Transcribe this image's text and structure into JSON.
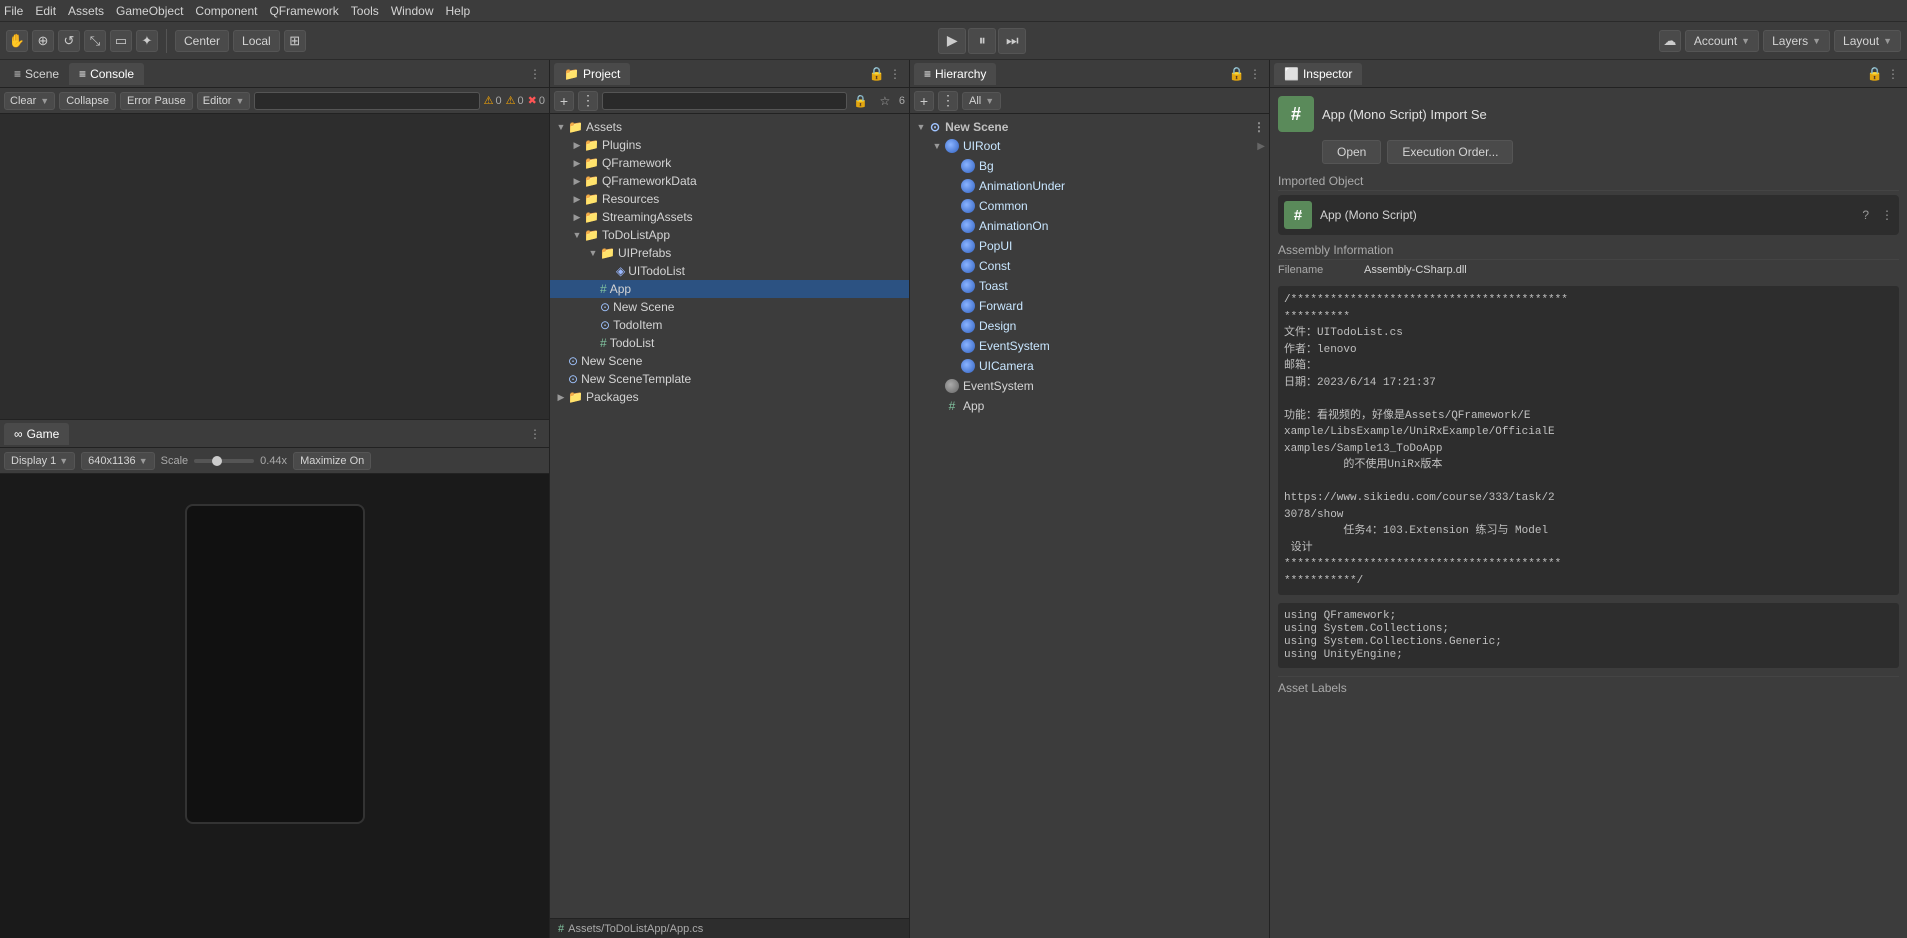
{
  "menuBar": {
    "items": [
      "File",
      "Edit",
      "Assets",
      "GameObject",
      "Component",
      "QFramework",
      "Tools",
      "Window",
      "Help"
    ]
  },
  "toolbar": {
    "handTool": "✋",
    "moveTool": "⊕",
    "rotateTool": "↺",
    "scaleTool": "⤡",
    "rectTool": "▭",
    "transformTool": "✦",
    "pivotBtn": "Center",
    "spaceBtn": "Local",
    "customBtn": "⊞",
    "playBtn": "▶",
    "pauseBtn": "⏸",
    "stepBtn": "⏭",
    "cloudIcon": "☁",
    "accountBtn": "Account",
    "layersBtn": "Layers",
    "layoutBtn": "Layout"
  },
  "scenePanel": {
    "tabs": [
      {
        "label": "Scene",
        "icon": "≡",
        "active": false
      },
      {
        "label": "Console",
        "icon": "≡",
        "active": true
      }
    ],
    "consoleBtns": [
      "Clear",
      "Collapse",
      "Error Pause"
    ],
    "editorDropdown": "Editor",
    "badges": [
      {
        "icon": "⚠",
        "count": "0"
      },
      {
        "icon": "⚠",
        "count": "0"
      },
      {
        "icon": "✖",
        "count": "0"
      }
    ]
  },
  "gamePanel": {
    "title": "Game",
    "displayDropdown": "Display 1",
    "resolutionDropdown": "640x1136",
    "scaleLabel": "Scale",
    "scaleValue": "0.44x",
    "maximizeBtn": "Maximize On"
  },
  "projectPanel": {
    "title": "Project",
    "lockIcon": "🔒",
    "tree": {
      "root": "Assets",
      "items": [
        {
          "id": "plugins",
          "label": "Plugins",
          "type": "folder",
          "depth": 1,
          "expanded": false
        },
        {
          "id": "qframework",
          "label": "QFramework",
          "type": "folder",
          "depth": 1,
          "expanded": false
        },
        {
          "id": "qframeworkdata",
          "label": "QFrameworkData",
          "type": "folder",
          "depth": 1,
          "expanded": false
        },
        {
          "id": "resources",
          "label": "Resources",
          "type": "folder",
          "depth": 1,
          "expanded": false
        },
        {
          "id": "streamingassets",
          "label": "StreamingAssets",
          "type": "folder",
          "depth": 1,
          "expanded": false
        },
        {
          "id": "todolistapp",
          "label": "ToDoListApp",
          "type": "folder",
          "depth": 1,
          "expanded": true
        },
        {
          "id": "uiprefabs",
          "label": "UIPrefabs",
          "type": "folder",
          "depth": 2,
          "expanded": true
        },
        {
          "id": "uitodolist",
          "label": "UITodoList",
          "type": "prefab",
          "depth": 3
        },
        {
          "id": "app",
          "label": "App",
          "type": "script",
          "depth": 2
        },
        {
          "id": "newscene",
          "label": "New Scene",
          "type": "scene",
          "depth": 2
        },
        {
          "id": "todoitem",
          "label": "TodoItem",
          "type": "scene",
          "depth": 2
        },
        {
          "id": "todolist",
          "label": "TodoList",
          "type": "script",
          "depth": 2
        }
      ],
      "rootItems2": [
        {
          "id": "newscene2",
          "label": "New Scene",
          "type": "scene",
          "depth": 0
        },
        {
          "id": "newscenetemplate",
          "label": "New SceneTemplate",
          "type": "scene",
          "depth": 0
        }
      ],
      "packagesFolder": "Packages"
    },
    "statusBar": "Assets/ToDoListApp/App.cs"
  },
  "hierarchyPanel": {
    "title": "Hierarchy",
    "allDropdown": "All",
    "scene": {
      "name": "New Scene",
      "children": [
        {
          "id": "uiroot",
          "label": "UIRoot",
          "type": "component",
          "depth": 1,
          "expanded": true,
          "children": [
            {
              "id": "bg",
              "label": "Bg",
              "type": "component",
              "depth": 2
            },
            {
              "id": "animunder",
              "label": "AnimationUnder",
              "type": "component",
              "depth": 2
            },
            {
              "id": "common",
              "label": "Common",
              "type": "component",
              "depth": 2
            },
            {
              "id": "animon",
              "label": "AnimationOn",
              "type": "component",
              "depth": 2
            },
            {
              "id": "popui",
              "label": "PopUI",
              "type": "component",
              "depth": 2
            },
            {
              "id": "const",
              "label": "Const",
              "type": "component",
              "depth": 2
            },
            {
              "id": "toast",
              "label": "Toast",
              "type": "component",
              "depth": 2
            },
            {
              "id": "forward",
              "label": "Forward",
              "type": "component",
              "depth": 2
            },
            {
              "id": "design",
              "label": "Design",
              "type": "component",
              "depth": 2
            },
            {
              "id": "eventsystem",
              "label": "EventSystem",
              "type": "component",
              "depth": 2
            },
            {
              "id": "uicamera",
              "label": "UICamera",
              "type": "component",
              "depth": 2
            }
          ]
        },
        {
          "id": "eventsystem2",
          "label": "EventSystem",
          "type": "component",
          "depth": 1
        },
        {
          "id": "app2",
          "label": "App",
          "type": "script",
          "depth": 1
        }
      ]
    }
  },
  "inspectorPanel": {
    "title": "Inspector",
    "lockIcon": "🔒",
    "scriptName": "App (Mono Script) Import Se",
    "hashIcon": "#",
    "openBtn": "Open",
    "executionOrderBtn": "Execution Order...",
    "importedObject": {
      "label": "Imported Object",
      "name": "App (Mono Script)",
      "helpIcon": "?"
    },
    "assemblyInfo": {
      "header": "Assembly Information",
      "filename": "Filename",
      "filenameVal": "Assembly-CSharp.dll"
    },
    "codeComment": "/******************************************\n**********\n文件：UITodoList.cs\n作者：lenovo\n邮箱：\n日期：2023/6/14 17:21:37\n\n功能：看视频的，好像是Assets/QFramework/E\nxample/LibsExample/UniRxExample/OfficialE\nxamples/Sample13_ToDoApp\n         的不使用UniRx版本\n\nhttps://www.sikiedu.com/course/333/task/2\n3078/show\n         任务4：103.Extension 练习与 Model\n 设计\n******************************************\n***********/",
    "usings": [
      "using QFramework;",
      "using System.Collections;",
      "using System.Collections.Generic;",
      "using UnityEngine;"
    ],
    "assetLabels": "Asset Labels"
  },
  "colors": {
    "accent": "#2c5282",
    "background": "#3c3c3c",
    "darkBg": "#2d2d2d",
    "border": "#222",
    "folderIcon": "#d4a843",
    "sceneIcon": "#a0c4ff",
    "scriptIcon": "#82c4a0",
    "prefabIcon": "#9ab8ff",
    "componentSphere": "#8ab4ff"
  }
}
